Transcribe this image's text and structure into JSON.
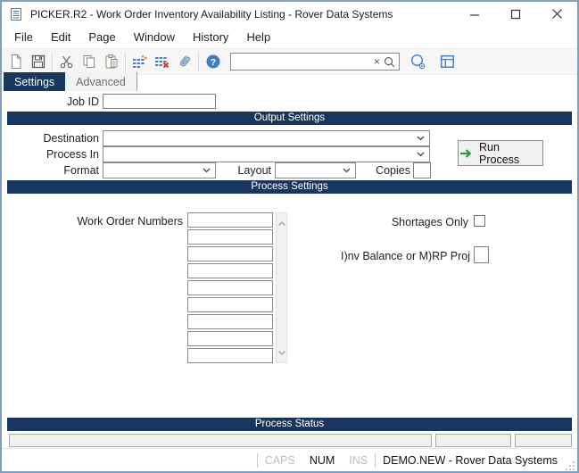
{
  "window": {
    "icon": "document-list-icon",
    "title": "PICKER.R2 - Work Order Inventory Availability Listing - Rover Data Systems"
  },
  "menu": {
    "items": [
      "File",
      "Edit",
      "Page",
      "Window",
      "History",
      "Help"
    ]
  },
  "toolbar": {
    "icons": [
      "new-document-icon",
      "save-icon",
      "cut-icon",
      "copy-icon",
      "paste-icon",
      "records-icon",
      "records-delete-icon",
      "attachment-icon",
      "help-icon",
      "search-clear-icon",
      "search-icon",
      "find-preview-icon",
      "layout-icon"
    ],
    "search": {
      "value": ""
    }
  },
  "tabs": {
    "items": [
      {
        "label": "Settings",
        "active": true
      },
      {
        "label": "Advanced",
        "active": false
      }
    ]
  },
  "form": {
    "job_id": {
      "label": "Job ID",
      "value": ""
    },
    "output": {
      "header": "Output Settings",
      "destination": {
        "label": "Destination",
        "value": ""
      },
      "process_in": {
        "label": "Process In",
        "value": ""
      },
      "format": {
        "label": "Format",
        "value": ""
      },
      "layout": {
        "label": "Layout",
        "value": ""
      },
      "copies": {
        "label": "Copies",
        "value": ""
      },
      "run_button": {
        "label": "Run Process"
      }
    },
    "process": {
      "header": "Process Settings",
      "work_orders": {
        "label": "Work Order Numbers",
        "values": [
          "",
          "",
          "",
          "",
          "",
          "",
          "",
          "",
          ""
        ]
      },
      "shortages": {
        "label": "Shortages Only",
        "checked": false
      },
      "inv_balance": {
        "label": "I)nv Balance or M)RP Proj",
        "value": ""
      }
    },
    "status_section": {
      "header": "Process Status"
    }
  },
  "status_bar": {
    "caps": "CAPS",
    "num": "NUM",
    "ins": "INS",
    "session": "DEMO.NEW - Rover Data Systems"
  },
  "colors": {
    "navy": "#17375e",
    "run_arrow_green": "#1f9d3f",
    "icon_blue": "#4d7ebf",
    "icon_orange": "#e39a35",
    "icon_red": "#c43a2f",
    "frame_blue": "#7e9fc0"
  }
}
